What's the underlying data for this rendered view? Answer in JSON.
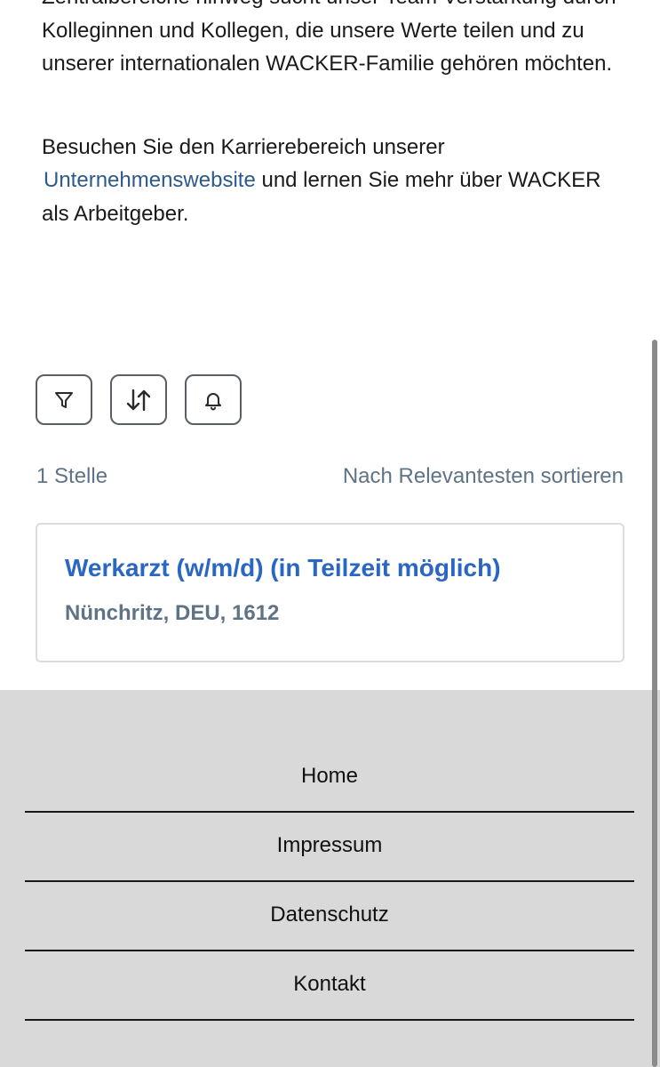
{
  "intro": {
    "line_top": "Zentralbereiche hinweg sucht unser Team Verstärkung",
    "paragraph1_rest": "durch Kolleginnen und Kollegen, die unsere Werte teilen und zu unserer internationalen WACKER-Familie gehören möchten.",
    "paragraph2_before": "Besuchen Sie den Karrierebereich unserer ",
    "paragraph2_link": "Unternehmenswebsite",
    "paragraph2_after": " und lernen Sie mehr über WACKER als Arbeitgeber."
  },
  "toolbar": {
    "filter_icon": "filter-icon",
    "sort_icon": "sort-arrows-icon",
    "alert_icon": "bell-icon"
  },
  "results": {
    "count_label": "1 Stelle",
    "sort_label": "Nach Relevantesten sortieren"
  },
  "jobs": [
    {
      "title": "Werkarzt (w/m/d) (in Teilzeit möglich)",
      "location": "Nünchritz, DEU, 1612"
    }
  ],
  "footer": {
    "links": [
      "Home",
      "Impressum",
      "Datenschutz",
      "Kontakt"
    ]
  },
  "colors": {
    "link": "#2c5a8c",
    "job_title": "#2a66c4",
    "muted_text": "#5f7386",
    "footer_bg": "#d9d9d9"
  }
}
